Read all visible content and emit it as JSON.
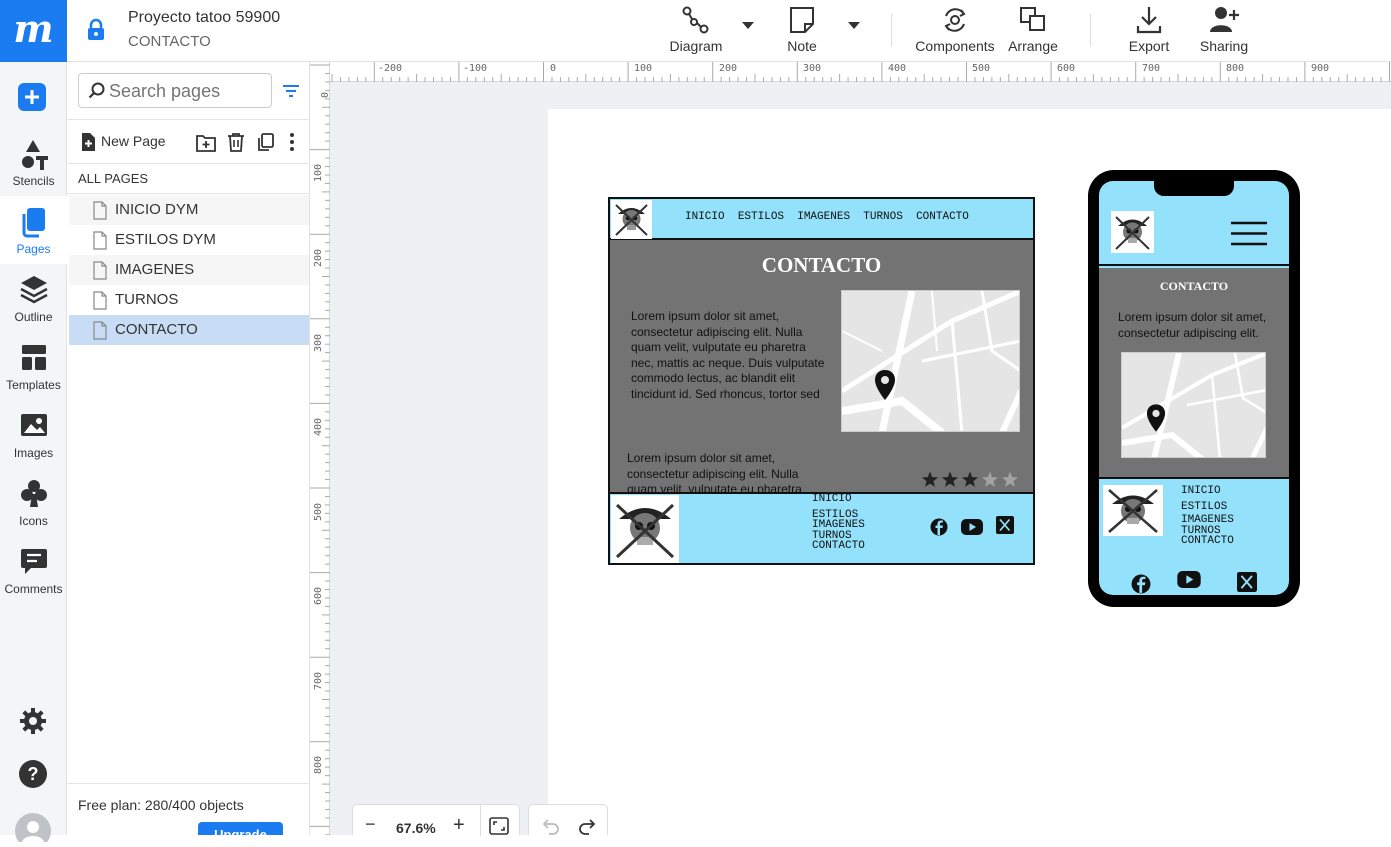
{
  "header": {
    "project_title": "Proyecto tatoo 59900",
    "page_name": "CONTACTO",
    "logo_letter": "m"
  },
  "toolbar": {
    "diagram_label": "Diagram",
    "note_label": "Note",
    "components_label": "Components",
    "arrange_label": "Arrange",
    "export_label": "Export",
    "sharing_label": "Sharing"
  },
  "leftrail": {
    "stencils": "Stencils",
    "pages": "Pages",
    "outline": "Outline",
    "templates": "Templates",
    "images": "Images",
    "icons": "Icons",
    "comments": "Comments"
  },
  "pages_panel": {
    "search_placeholder": "Search pages",
    "new_page_label": "New Page",
    "all_pages_label": "ALL PAGES",
    "pages": [
      {
        "label": "INICIO DYM",
        "selected": false
      },
      {
        "label": "ESTILOS DYM",
        "selected": false
      },
      {
        "label": "IMAGENES",
        "selected": false
      },
      {
        "label": "TURNOS",
        "selected": false
      },
      {
        "label": "CONTACTO",
        "selected": true
      }
    ],
    "plan_text": "Free plan: 280/400 objects",
    "upgrade_label": "Upgrade"
  },
  "ruler": {
    "horizontal": [
      "-200",
      "-100",
      "0",
      "100",
      "200",
      "300",
      "400",
      "500",
      "600",
      "700",
      "800",
      "900"
    ],
    "vertical": [
      "0",
      "100",
      "200",
      "300",
      "400",
      "500",
      "600",
      "700",
      "800"
    ]
  },
  "zoom": {
    "level": "67.6%",
    "minus": "−",
    "plus": "+"
  },
  "desktop_mockup": {
    "nav": [
      "INICIO",
      "ESTILOS",
      "IMAGENES",
      "TURNOS",
      "CONTACTO"
    ],
    "heading": "CONTACTO",
    "paragraph1": "Lorem ipsum dolor sit amet, consectetur adipiscing elit. Nulla quam velit, vulputate eu pharetra nec, mattis ac neque. Duis vulputate commodo lectus, ac blandit elit tincidunt id. Sed rhoncus, tortor sed",
    "paragraph2": "Lorem ipsum dolor sit amet, consectetur adipiscing elit. Nulla quam velit, vulputate eu pharetra",
    "rating": 3,
    "rating_max": 5,
    "footer_links": [
      "INICIO",
      "ESTILOS",
      "IMAGENES",
      "TURNOS",
      "CONTACTO"
    ]
  },
  "mobile_mockup": {
    "heading": "CONTACTO",
    "paragraph": "Lorem ipsum dolor sit amet, consectetur adipiscing elit.",
    "footer_links": [
      "INICIO",
      "ESTILOS",
      "IMAGENES",
      "TURNOS",
      "CONTACTO"
    ]
  },
  "colors": {
    "accent": "#1a7cf0",
    "selected_row": "#c9dcf5",
    "mockup_cyan": "#93e1fa",
    "mockup_gray": "#737373"
  }
}
